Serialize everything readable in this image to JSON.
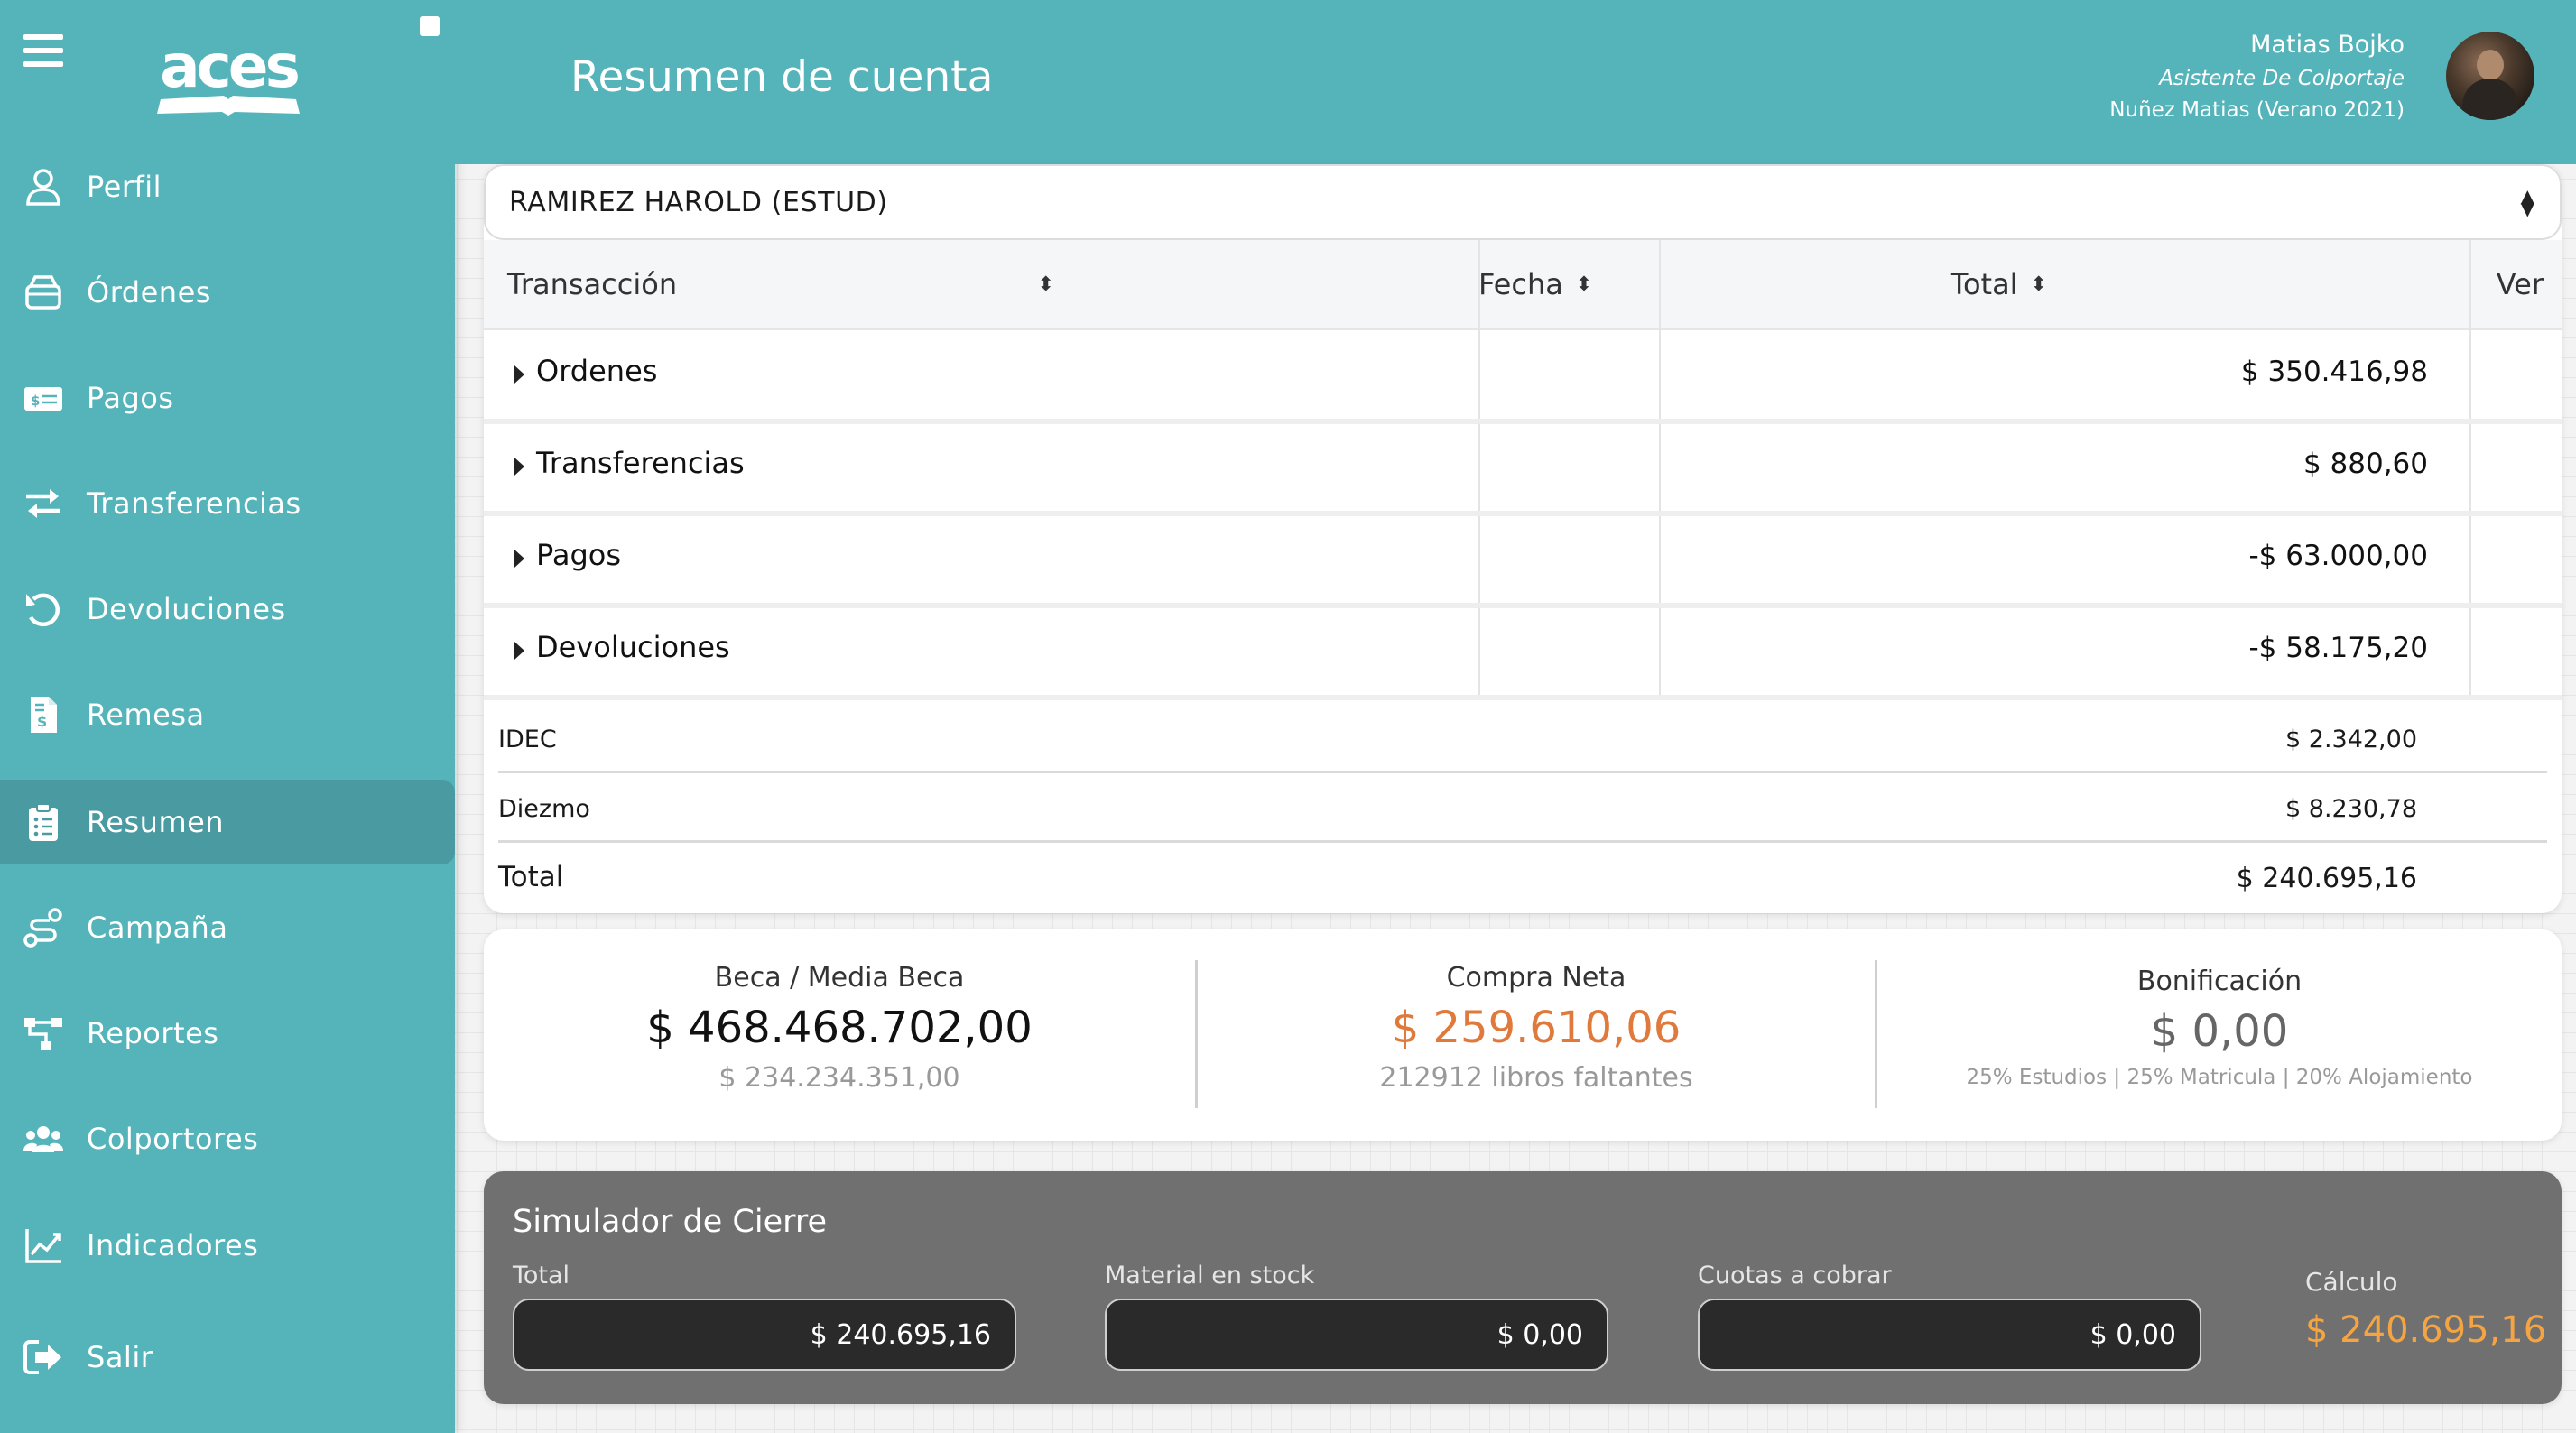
{
  "colors": {
    "primary": "#55b4ba",
    "active_nav": "#4a9aa2",
    "orange_value": "#e07a3c",
    "calc_value": "#f4a442",
    "simulator_bg": "#707070"
  },
  "sidebar": {
    "logo_text": "aces",
    "items": [
      {
        "label": "Perfil",
        "icon": "user-icon"
      },
      {
        "label": "Órdenes",
        "icon": "box-icon"
      },
      {
        "label": "Pagos",
        "icon": "money-bill-icon"
      },
      {
        "label": "Transferencias",
        "icon": "exchange-icon"
      },
      {
        "label": "Devoluciones",
        "icon": "undo-icon"
      },
      {
        "label": "Remesa",
        "icon": "file-invoice-dollar-icon"
      },
      {
        "label": "Resumen",
        "icon": "clipboard-list-icon",
        "active": true
      },
      {
        "label": "Campaña",
        "icon": "route-icon"
      },
      {
        "label": "Reportes",
        "icon": "sitemap-icon"
      },
      {
        "label": "Colportores",
        "icon": "users-icon"
      },
      {
        "label": "Indicadores",
        "icon": "chart-line-icon"
      },
      {
        "label": "Salir",
        "icon": "sign-out-icon"
      }
    ]
  },
  "header": {
    "title": "Resumen de cuenta",
    "user_name": "Matias Bojko",
    "user_role": "Asistente De Colportaje",
    "user_campaign": "Nuñez Matias (Verano 2021)"
  },
  "account_select": {
    "selected": "RAMIREZ HAROLD (ESTUD)"
  },
  "table": {
    "headers": {
      "transaction": "Transacción",
      "date": "Fecha",
      "total": "Total",
      "view": "Ver"
    },
    "rows": [
      {
        "name": "Ordenes",
        "amount": "$ 350.416,98"
      },
      {
        "name": "Transferencias",
        "amount": "$ 880,60"
      },
      {
        "name": "Pagos",
        "amount": "-$ 63.000,00"
      },
      {
        "name": "Devoluciones",
        "amount": "-$ 58.175,20"
      }
    ],
    "summary": [
      {
        "name": "IDEC",
        "amount": "$ 2.342,00"
      },
      {
        "name": "Diezmo",
        "amount": "$ 8.230,78"
      },
      {
        "name": "Total",
        "amount": "$ 240.695,16"
      }
    ]
  },
  "stats": {
    "beca": {
      "title": "Beca / Media Beca",
      "value": "$ 468.468.702,00",
      "sub": "$ 234.234.351,00"
    },
    "compra": {
      "title": "Compra Neta",
      "value": "$ 259.610,06",
      "sub": "212912 libros faltantes"
    },
    "bonificacion": {
      "title": "Bonificación",
      "value": "$ 0,00",
      "sub": "25% Estudios | 25% Matricula | 20% Alojamiento"
    }
  },
  "simulator": {
    "title": "Simulador de Cierre",
    "total_label": "Total",
    "total_value": "$ 240.695,16",
    "stock_label": "Material en stock",
    "stock_value": "$ 0,00",
    "cuotas_label": "Cuotas a cobrar",
    "cuotas_value": "$ 0,00",
    "calc_label": "Cálculo",
    "calc_value": "$ 240.695,16"
  }
}
